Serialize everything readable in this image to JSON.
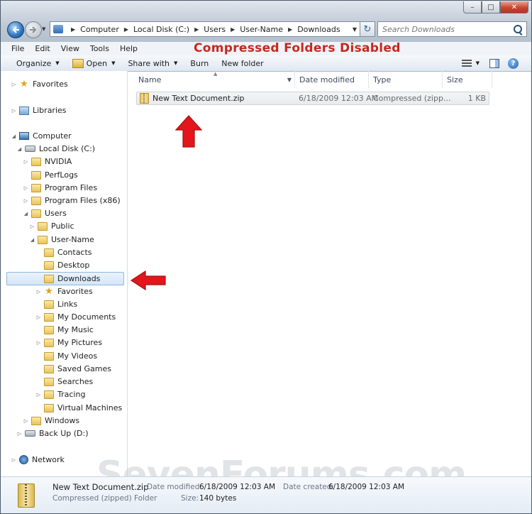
{
  "window": {
    "close_symbol": "✕",
    "maximize_symbol": "□",
    "minimize_symbol": "–"
  },
  "breadcrumb": [
    "Computer",
    "Local Disk (C:)",
    "Users",
    "User-Name",
    "Downloads"
  ],
  "search": {
    "placeholder": "Search Downloads"
  },
  "menubar": {
    "items": [
      "File",
      "Edit",
      "View",
      "Tools",
      "Help"
    ]
  },
  "banner_text": "Compressed Folders Disabled",
  "toolbar": {
    "organize": "Organize",
    "open": "Open",
    "share_with": "Share with",
    "burn": "Burn",
    "new_folder": "New folder",
    "help": "?"
  },
  "nav_tree": [
    {
      "label": "Favorites",
      "icon": "star-icon"
    },
    {
      "label": "Libraries",
      "icon": "library-icon"
    },
    {
      "label": "Computer",
      "icon": "computer-icon"
    },
    {
      "label": "Local Disk (C:)",
      "icon": "disk-icon"
    },
    {
      "label": "NVIDIA",
      "icon": "folder-icon"
    },
    {
      "label": "PerfLogs",
      "icon": "folder-icon"
    },
    {
      "label": "Program Files",
      "icon": "folder-icon"
    },
    {
      "label": "Program Files (x86)",
      "icon": "folder-icon"
    },
    {
      "label": "Users",
      "icon": "folder-icon"
    },
    {
      "label": "Public",
      "icon": "folder-icon"
    },
    {
      "label": "User-Name",
      "icon": "folder-icon"
    },
    {
      "label": "Contacts",
      "icon": "folder-icon"
    },
    {
      "label": "Desktop",
      "icon": "folder-icon"
    },
    {
      "label": "Downloads",
      "icon": "folder-icon"
    },
    {
      "label": "Favorites",
      "icon": "star-icon"
    },
    {
      "label": "Links",
      "icon": "folder-icon"
    },
    {
      "label": "My Documents",
      "icon": "folder-icon"
    },
    {
      "label": "My Music",
      "icon": "folder-icon"
    },
    {
      "label": "My Pictures",
      "icon": "folder-icon"
    },
    {
      "label": "My Videos",
      "icon": "folder-icon"
    },
    {
      "label": "Saved Games",
      "icon": "folder-icon"
    },
    {
      "label": "Searches",
      "icon": "folder-icon"
    },
    {
      "label": "Tracing",
      "icon": "folder-icon"
    },
    {
      "label": "Virtual Machines",
      "icon": "folder-icon"
    },
    {
      "label": "Windows",
      "icon": "folder-icon"
    },
    {
      "label": "Back Up (D:)",
      "icon": "disk-icon"
    },
    {
      "label": "Network",
      "icon": "network-icon"
    }
  ],
  "columns": [
    "Name",
    "Date modified",
    "Type",
    "Size"
  ],
  "files": [
    {
      "name": "New Text Document.zip",
      "date_modified": "6/18/2009 12:03 AM",
      "type": "Compressed (zipp...",
      "size": "1 KB"
    }
  ],
  "details": {
    "name": "New Text Document.zip",
    "type": "Compressed (zipped) Folder",
    "date_modified_label": "Date modified:",
    "date_modified": "6/18/2009 12:03 AM",
    "date_created_label": "Date created:",
    "date_created": "6/18/2009 12:03 AM",
    "size_label": "Size:",
    "size": "140 bytes"
  },
  "watermark": "SevenForums.com",
  "colors": {
    "banner": "#c42a1f",
    "arrow": "#e3161b",
    "selection": "#d4e6f8"
  }
}
